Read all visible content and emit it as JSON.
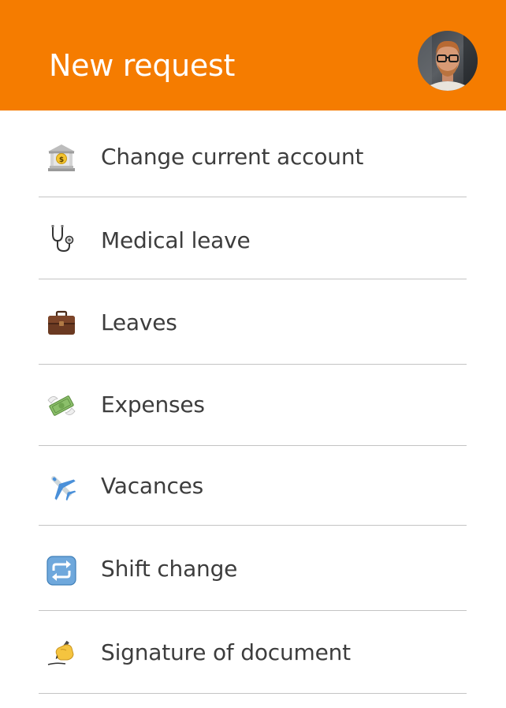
{
  "header": {
    "title": "New request",
    "background_color": "#F57C00"
  },
  "avatar": {
    "icon": "user-avatar-photo"
  },
  "request_types": [
    {
      "label": "Change current account",
      "icon": "bank-icon"
    },
    {
      "label": "Medical leave",
      "icon": "stethoscope-icon"
    },
    {
      "label": "Leaves",
      "icon": "briefcase-icon"
    },
    {
      "label": "Expenses",
      "icon": "money-with-wings-icon"
    },
    {
      "label": "Vacances",
      "icon": "airplane-icon"
    },
    {
      "label": "Shift change",
      "icon": "repeat-arrows-icon"
    },
    {
      "label": "Signature of document",
      "icon": "writing-hand-icon"
    }
  ]
}
